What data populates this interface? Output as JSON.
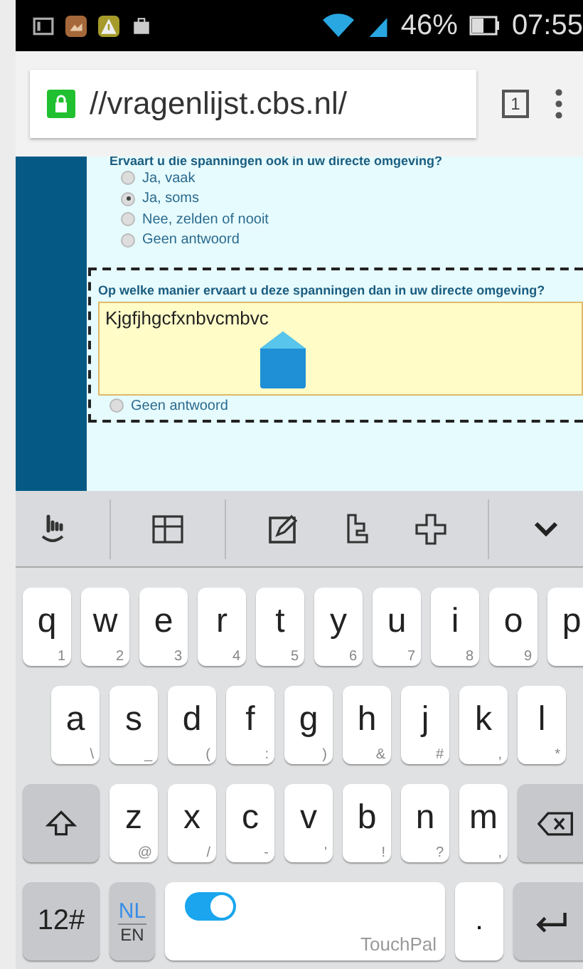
{
  "status_bar": {
    "battery": "46%",
    "time": "07:55"
  },
  "browser": {
    "url": "//vragenlijst.cbs.nl/",
    "tab_count": "1"
  },
  "question_1": {
    "title": "Ervaart u die spanningen ook in uw directe omgeving?",
    "options": [
      {
        "label": "Ja, vaak",
        "selected": false
      },
      {
        "label": "Ja, soms",
        "selected": true
      },
      {
        "label": "Nee, zelden of nooit",
        "selected": false
      },
      {
        "label": "Geen antwoord",
        "selected": false
      }
    ]
  },
  "question_2": {
    "title": "Op welke manier ervaart u deze spanningen dan in uw directe omgeving?",
    "value": "Kjgfjhgcfxnbvcmbvc",
    "options": [
      {
        "label": "Geen antwoord",
        "selected": false
      }
    ]
  },
  "keyboard": {
    "rows": [
      [
        {
          "key": "q",
          "hint": "1"
        },
        {
          "key": "w",
          "hint": "2"
        },
        {
          "key": "e",
          "hint": "3"
        },
        {
          "key": "r",
          "hint": "4"
        },
        {
          "key": "t",
          "hint": "5"
        },
        {
          "key": "y",
          "hint": "6"
        },
        {
          "key": "u",
          "hint": "7"
        },
        {
          "key": "i",
          "hint": "8"
        },
        {
          "key": "o",
          "hint": "9"
        },
        {
          "key": "p"
        }
      ],
      [
        {
          "key": "a",
          "hint": "\\"
        },
        {
          "key": "s",
          "hint": "_"
        },
        {
          "key": "d",
          "hint": "("
        },
        {
          "key": "f",
          "hint": ":"
        },
        {
          "key": "g",
          "hint": ")"
        },
        {
          "key": "h",
          "hint": "&"
        },
        {
          "key": "j",
          "hint": "#"
        },
        {
          "key": "k",
          "hint": ","
        },
        {
          "key": "l",
          "hint": "*"
        }
      ],
      [
        {
          "key": "z",
          "hint": "@"
        },
        {
          "key": "x",
          "hint": "/"
        },
        {
          "key": "c",
          "hint": "-"
        },
        {
          "key": "v",
          "hint": "'"
        },
        {
          "key": "b",
          "hint": "!"
        },
        {
          "key": "n",
          "hint": "?"
        },
        {
          "key": "m",
          "hint": ","
        }
      ]
    ],
    "symbols_key": "12#",
    "lang_primary": "NL",
    "lang_secondary": "EN",
    "toggle_on": true,
    "space_label": "TouchPal",
    "period_key": "."
  }
}
